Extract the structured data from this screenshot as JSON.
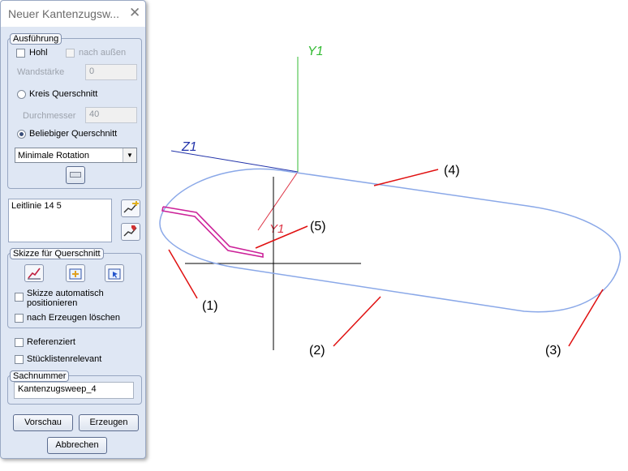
{
  "dialog": {
    "title": "Neuer Kantenzugsw...",
    "ausfuehrung": {
      "legend": "Ausführung",
      "hohl_label": "Hohl",
      "nach_aussen_label": "nach außen",
      "wandstaerke_label": "Wandstärke",
      "wandstaerke_value": "0",
      "kreis_label": "Kreis Querschnitt",
      "durchmesser_label": "Durchmesser",
      "durchmesser_value": "40",
      "beliebig_label": "Beliebiger Querschnitt",
      "rotation_selected": "Minimale Rotation"
    },
    "leitlinie_item": "Leitlinie 14 5",
    "skizze": {
      "legend": "Skizze für Querschnitt",
      "auto_pos_label_line1": "Skizze automatisch",
      "auto_pos_label_line2": "positionieren",
      "delete_label": "nach Erzeugen löschen"
    },
    "referenziert_label": "Referenziert",
    "stueckliste_label": "Stücklistenrelevant",
    "sachnummer": {
      "legend": "Sachnummer",
      "value": "Kantenzugsweep_4"
    },
    "buttons": {
      "vorschau": "Vorschau",
      "erzeugen": "Erzeugen",
      "abbrechen": "Abbrechen"
    }
  },
  "viewport": {
    "axis_y1": "Y1",
    "axis_z1": "Z1",
    "axis_y1_small": "Y1",
    "callouts": [
      "(1)",
      "(2)",
      "(3)",
      "(4)",
      "(5)"
    ]
  },
  "colors": {
    "axis_green": "#33bb33",
    "axis_blue": "#2233aa",
    "axis_red": "#dd3344",
    "path_blue": "#8aa8e8",
    "profile_magenta": "#cc2299",
    "callout_red": "#e01010"
  }
}
